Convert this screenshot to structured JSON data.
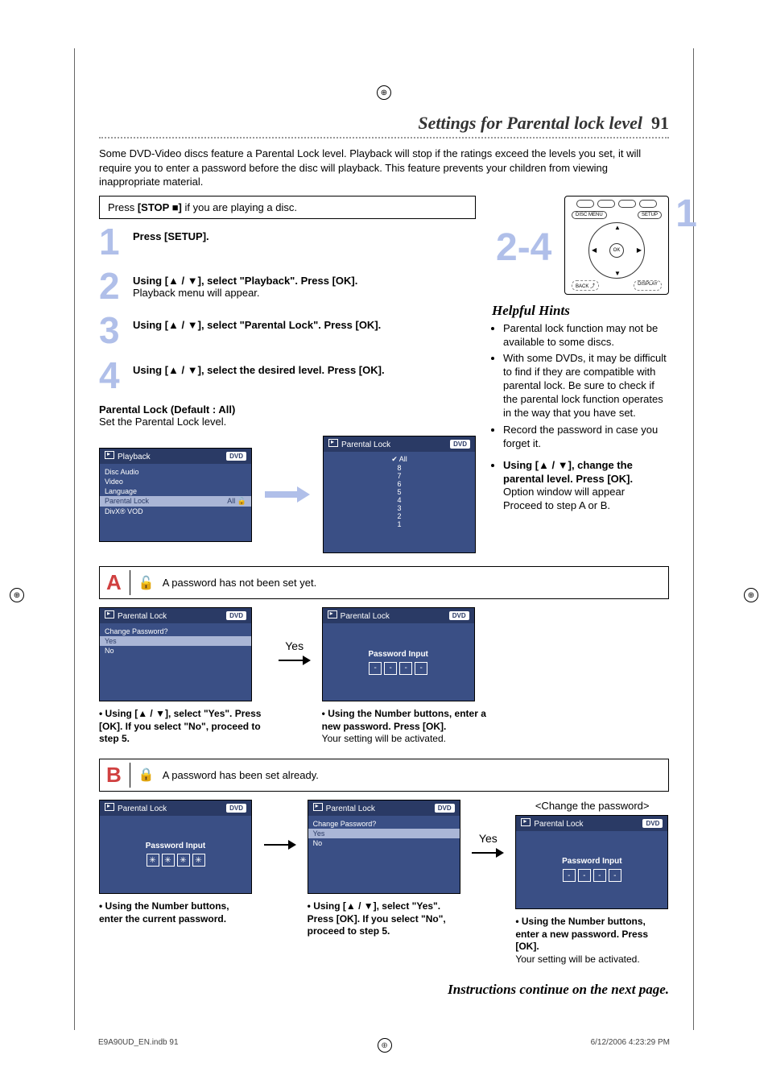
{
  "header": {
    "title": "Settings for Parental lock level",
    "page_number": "91"
  },
  "intro": "Some DVD-Video discs feature a Parental Lock level. Playback will stop if the ratings exceed the levels you set, it will require you to enter a password before the disc will playback. This feature prevents your children from viewing inappropriate material.",
  "stop_box": {
    "prefix": "Press ",
    "button": "[STOP ■]",
    "suffix": " if you are playing a disc."
  },
  "steps": {
    "s1": {
      "num": "1",
      "bold": "Press [SETUP]."
    },
    "s2": {
      "num": "2",
      "bold": "Using [▲ / ▼], select \"Playback\". Press [OK].",
      "sub": "Playback menu will appear."
    },
    "s3": {
      "num": "3",
      "bold": "Using [▲ / ▼], select \"Parental Lock\". Press [OK]."
    },
    "s4": {
      "num": "4",
      "bold": "Using [▲ / ▼], select the desired level. Press [OK]."
    }
  },
  "parental_heading": "Parental Lock (Default : All)",
  "parental_sub": "Set the Parental Lock level.",
  "remote": {
    "callout1": "1",
    "callout24": "2-4",
    "disc_menu": "DISC MENU",
    "setup": "SETUP",
    "ok": "OK",
    "back": "BACK",
    "display": "DISPLAY"
  },
  "hints": {
    "head": "Helpful Hints",
    "items": [
      "Parental lock function may not be available to some discs.",
      "With some DVDs, it may be difficult to find if they are compatible with parental lock. Be sure to check if the parental lock function operates in the way that you have set.",
      "Record the password in case you forget it."
    ],
    "right_step_bold": "Using [▲ / ▼], change the parental level. Press [OK].",
    "right_step_sub1": "Option window will appear",
    "right_step_sub2": "Proceed to step A or B."
  },
  "osd_playback": {
    "title": "Playback",
    "badge": "DVD",
    "rows": [
      "Disc Audio",
      "Video",
      "Language"
    ],
    "sel_label": "Parental Lock",
    "sel_value": "All",
    "last": "DivX® VOD"
  },
  "osd_levels": {
    "title": "Parental Lock",
    "badge": "DVD",
    "all": "All",
    "levels": [
      "8",
      "7",
      "6",
      "5",
      "4",
      "3",
      "2",
      "1"
    ]
  },
  "sectionA": {
    "letter": "A",
    "text": "A password has not been set yet."
  },
  "osd_changepw": {
    "title": "Parental Lock",
    "badge": "DVD",
    "q": "Change Password?",
    "yes": "Yes",
    "no": "No"
  },
  "yes_label": "Yes",
  "osd_pwinput": {
    "title": "Parental Lock",
    "badge": "DVD",
    "label": "Password Input",
    "dash": "-",
    "star": "✳"
  },
  "captionsA": {
    "c1_bold": "Using [▲ / ▼], select \"Yes\". Press [OK]. If you select \"No\", proceed to step 5.",
    "c2_bold": "Using the Number buttons, enter a new password. Press [OK].",
    "c2_sub": "Your setting will be activated."
  },
  "sectionB": {
    "letter": "B",
    "text": "A password has been set already."
  },
  "change_pw_head": "<Change the password>",
  "captionsB": {
    "c1_bold": "Using the Number buttons, enter the current password.",
    "c2_bold": "Using [▲ / ▼], select \"Yes\". Press [OK]. If you select \"No\", proceed to step 5.",
    "c3_bold": "Using the Number buttons, enter a new password. Press [OK].",
    "c3_sub": "Your setting will be activated."
  },
  "continue": "Instructions continue on the next page.",
  "footer": {
    "left": "E9A90UD_EN.indb   91",
    "right": "6/12/2006   4:23:29 PM"
  }
}
